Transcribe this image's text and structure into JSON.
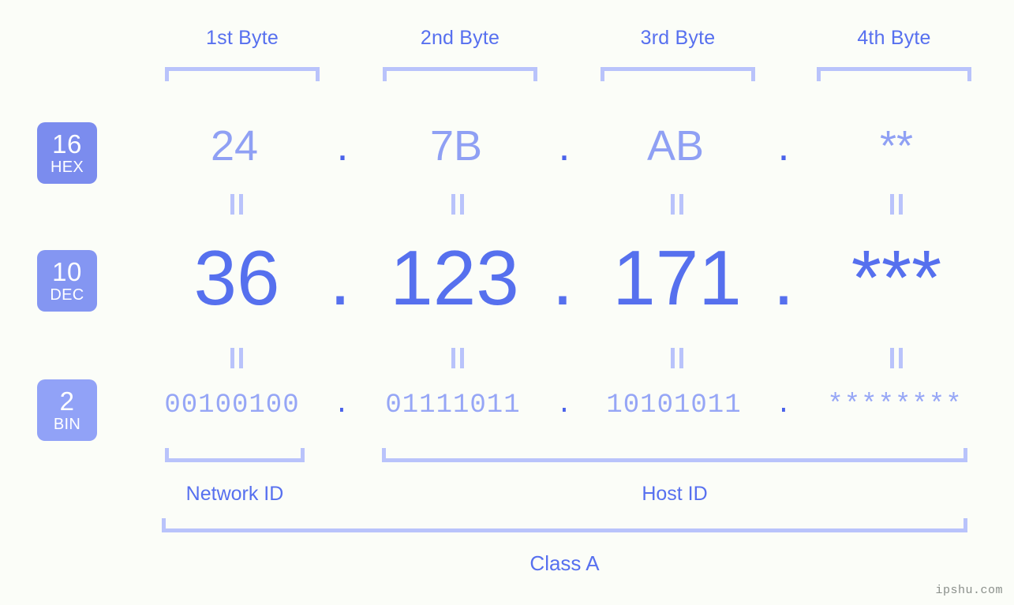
{
  "meta": {
    "watermark": "ipshu.com",
    "background_color": "#fbfdf8",
    "accent_strong": "#5670ee",
    "accent_light": "#96a6f6",
    "bracket_color": "#b9c3fb",
    "badge_hex_color": "#7b8cee",
    "badge_dec_color": "#8496f2",
    "badge_bin_color": "#91a2f7"
  },
  "headers": [
    {
      "label": "1st Byte"
    },
    {
      "label": "2nd Byte"
    },
    {
      "label": "3rd Byte"
    },
    {
      "label": "4th Byte"
    }
  ],
  "bases": [
    {
      "number": "16",
      "name": "HEX"
    },
    {
      "number": "10",
      "name": "DEC"
    },
    {
      "number": "2",
      "name": "BIN"
    }
  ],
  "rows": {
    "hex": {
      "values": [
        "24",
        "7B",
        "AB",
        "**"
      ],
      "separator": "."
    },
    "dec": {
      "values": [
        "36",
        "123",
        "171",
        "***"
      ],
      "separator": "."
    },
    "bin": {
      "values": [
        "00100100",
        "01111011",
        "10101011",
        "********"
      ],
      "separator": "."
    }
  },
  "equals_marks": {
    "symbol": "=",
    "count_per_gap": 4
  },
  "segments": [
    {
      "label": "Network ID"
    },
    {
      "label": "Host ID"
    }
  ],
  "class": {
    "label": "Class A"
  }
}
